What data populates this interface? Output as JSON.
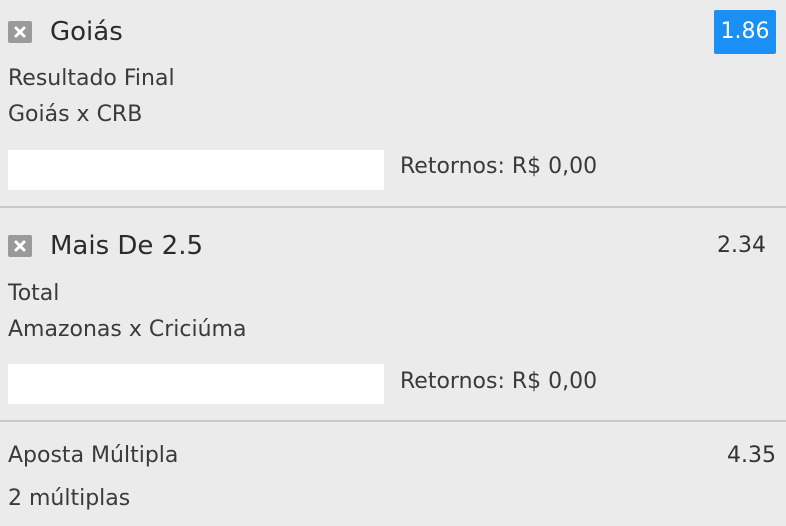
{
  "bets": [
    {
      "selection": "Goiás",
      "odds": "1.86",
      "market": "Resultado Final",
      "event": "Goiás x CRB",
      "stake_value": "",
      "returns_label": "Retornos: R$ 0,00",
      "icon": "close-icon"
    },
    {
      "selection": "Mais De 2.5",
      "odds": "2.34",
      "market": "Total",
      "event": "Amazonas x Criciúma",
      "stake_value": "",
      "returns_label": "Retornos: R$ 0,00",
      "icon": "close-icon"
    }
  ],
  "multiple": {
    "label": "Aposta Múltipla",
    "odds": "4.35",
    "count_label": "2 múltiplas"
  },
  "colors": {
    "background": "#ebebeb",
    "highlight": "#1a8ff5",
    "remove_icon": "#9a9a9a",
    "divider": "#c9c9c9"
  }
}
